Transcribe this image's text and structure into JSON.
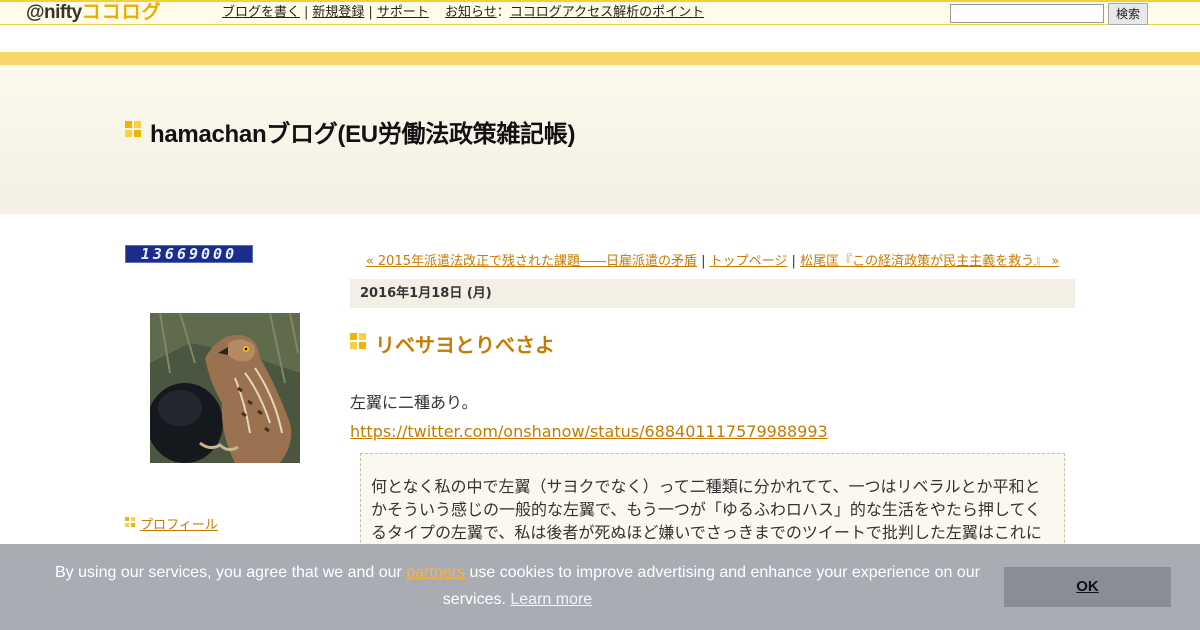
{
  "topbar": {
    "logo_prefix": "@nifty",
    "logo_brand": "ココログ",
    "nav": [
      "ブログを書く",
      "新規登録",
      "サポート"
    ],
    "news_label": "お知らせ",
    "news_colon": "：",
    "news_link": "ココログアクセス解析のポイント",
    "search_placeholder": "",
    "search_button": "検索"
  },
  "header": {
    "blog_title": "hamachanブログ(EU労働法政策雑記帳)"
  },
  "sidebar": {
    "counter": "13669000",
    "profile_link": "プロフィール"
  },
  "entry_nav": {
    "prev": "« 2015年派遣法改正で残された課題――日雇派遣の矛盾",
    "sep": " | ",
    "home": "トップページ",
    "next": "松尾匡『この経済政策が民主主義を救う』 »"
  },
  "entry": {
    "date": "2016年1月18日 (月)",
    "title": "リベサヨとりべさよ",
    "intro": "左翼に二種あり。",
    "link": "https://twitter.com/onshanow/status/688401117579988993",
    "quote_lines": [
      "何となく私の中で左翼（サヨクでなく）って二種類に分かれてて、一つはリベラルとか平和と",
      "かそういう感じの一般的な左翼で、もう一つが「ゆるふわロハス」的な生活をやたら押してく",
      "るタイプの左翼で、私は後者が死ぬほど嫌いでさっきまでのツイートで批判した左翼はこれに"
    ]
  },
  "cookie": {
    "text_before": "By using our services, you agree that we and our ",
    "partners": "partners",
    "text_after": " use cookies to improve advertising and enhance your experience on our services. ",
    "learn_more": "Learn more",
    "ok": "OK"
  }
}
